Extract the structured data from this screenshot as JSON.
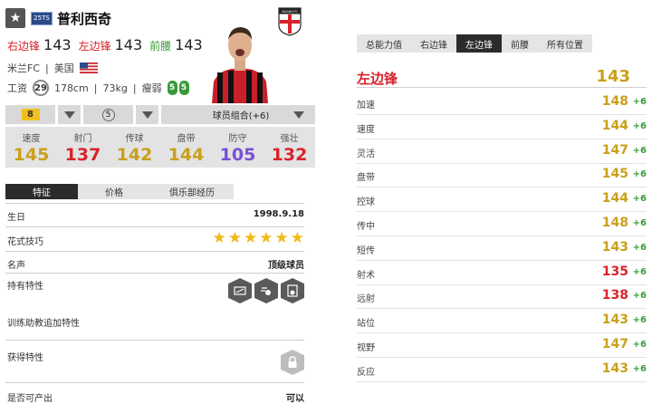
{
  "header": {
    "season_badge": "25TS",
    "player_name": "普利西奇",
    "club_crest_text": "MILANO FC"
  },
  "positions": [
    {
      "label": "右边锋",
      "value": "143",
      "color": "#d8232a"
    },
    {
      "label": "左边锋",
      "value": "143",
      "color": "#d8232a"
    },
    {
      "label": "前腰",
      "value": "143",
      "color": "#3a9a3a"
    }
  ],
  "info": {
    "club": "米兰FC",
    "nation": "美国",
    "salary_label": "工资",
    "salary": "29",
    "height": "178cm",
    "weight": "73kg",
    "body_type": "瘦弱",
    "weak_foot_left": "5",
    "weak_foot_right": "5"
  },
  "controls": {
    "upgrade_level": "8",
    "grade": "5",
    "team_color": "球员组合(+6)"
  },
  "stats": [
    {
      "label": "速度",
      "value": "145",
      "color": "#c9a01a"
    },
    {
      "label": "射门",
      "value": "137",
      "color": "#d8232a"
    },
    {
      "label": "传球",
      "value": "142",
      "color": "#c9a01a"
    },
    {
      "label": "盘带",
      "value": "144",
      "color": "#c9a01a"
    },
    {
      "label": "防守",
      "value": "105",
      "color": "#7b4fd6"
    },
    {
      "label": "强壮",
      "value": "132",
      "color": "#d8232a"
    }
  ],
  "detail_tabs": [
    "特征",
    "价格",
    "俱乐部经历"
  ],
  "details": {
    "birthday_label": "生日",
    "birthday": "1998.9.18",
    "skill_label": "花式技巧",
    "skill_stars": 6,
    "reputation_label": "名声",
    "reputation": "顶级球员",
    "traits_label": "持有特性",
    "coach_label": "训练助教追加特性",
    "acquired_label": "获得特性",
    "tradable_label": "是否可产出",
    "tradable": "可以"
  },
  "position_tabs": [
    "总能力值",
    "右边锋",
    "左边锋",
    "前腰",
    "所有位置"
  ],
  "active_position_tab": 2,
  "selected_position": {
    "label": "左边锋",
    "overall": "143"
  },
  "attributes": [
    {
      "name": "加速",
      "value": "148",
      "bonus": "+6",
      "color": "#c9a01a"
    },
    {
      "name": "速度",
      "value": "144",
      "bonus": "+6",
      "color": "#c9a01a"
    },
    {
      "name": "灵活",
      "value": "147",
      "bonus": "+6",
      "color": "#c9a01a"
    },
    {
      "name": "盘带",
      "value": "145",
      "bonus": "+6",
      "color": "#c9a01a"
    },
    {
      "name": "控球",
      "value": "144",
      "bonus": "+6",
      "color": "#c9a01a"
    },
    {
      "name": "传中",
      "value": "148",
      "bonus": "+6",
      "color": "#c9a01a"
    },
    {
      "name": "短传",
      "value": "143",
      "bonus": "+6",
      "color": "#c9a01a"
    },
    {
      "name": "射术",
      "value": "135",
      "bonus": "+6",
      "color": "#d8232a"
    },
    {
      "name": "远射",
      "value": "138",
      "bonus": "+6",
      "color": "#d8232a"
    },
    {
      "name": "站位",
      "value": "143",
      "bonus": "+6",
      "color": "#c9a01a"
    },
    {
      "name": "视野",
      "value": "147",
      "bonus": "+6",
      "color": "#c9a01a"
    },
    {
      "name": "反应",
      "value": "143",
      "bonus": "+6",
      "color": "#c9a01a"
    }
  ]
}
